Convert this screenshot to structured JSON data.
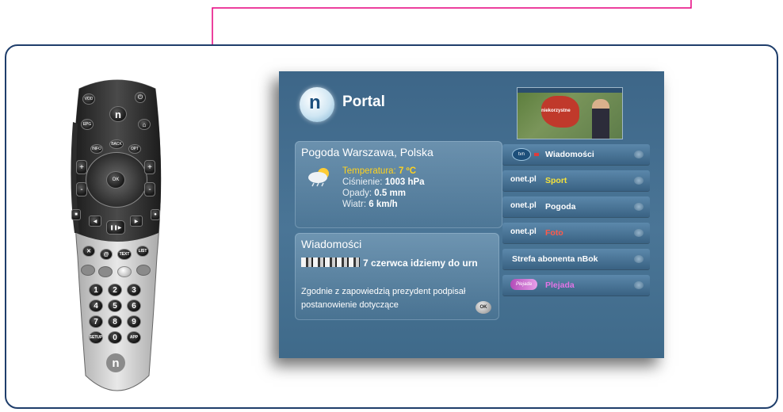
{
  "remote": {
    "buttons": {
      "vod": "VOD",
      "epg": "EPG",
      "info": "INFO",
      "back": "BACK",
      "opt": "OPT",
      "ok": "OK",
      "text": "TEXT",
      "list": "LIST",
      "at": "@",
      "setup": "SETUP",
      "app": "APP",
      "plus": "+",
      "minus": "-",
      "n_logo": "n"
    },
    "numbers": [
      "1",
      "2",
      "3",
      "4",
      "5",
      "6",
      "7",
      "8",
      "9",
      "0"
    ]
  },
  "portal": {
    "logo": "n",
    "title": "Portal",
    "weather": {
      "title": "Pogoda Warszawa, Polska",
      "temperature_label": "Temperatura:",
      "temperature_value": "7 ºC",
      "pressure_label": "Ciśnienie:",
      "pressure_value": "1003 hPa",
      "rain_label": "Opady:",
      "rain_value": "0.5 mm",
      "wind_label": "Wiatr:",
      "wind_value": "6 km/h"
    },
    "news": {
      "title": "Wiadomości",
      "headline": "7 czerwca idziemy do urn",
      "body": "Zgodnie z zapowiedzią prezydent podpisał postanowienie dotyczące",
      "ok_badge": "OK"
    },
    "thumbnail": {
      "caption": "niekorzystne"
    },
    "menu": [
      {
        "brand": "tvn",
        "label": "Wiadomości",
        "color": "#ffffff"
      },
      {
        "brand": "onet.pl",
        "label": "Sport",
        "color": "#f5e23a"
      },
      {
        "brand": "onet.pl",
        "label": "Pogoda",
        "color": "#ffffff"
      },
      {
        "brand": "onet.pl",
        "label": "Foto",
        "color": "#ff5a4a"
      },
      {
        "brand": "",
        "label": "Strefa abonenta nBok",
        "color": "#ffffff"
      },
      {
        "brand": "Plejada",
        "label": "Plejada",
        "color": "#e374e6"
      }
    ]
  },
  "colors": {
    "frame_border": "#1f3e6b",
    "pointer_line": "#e6007e",
    "screen_bg": "#4a7596"
  }
}
